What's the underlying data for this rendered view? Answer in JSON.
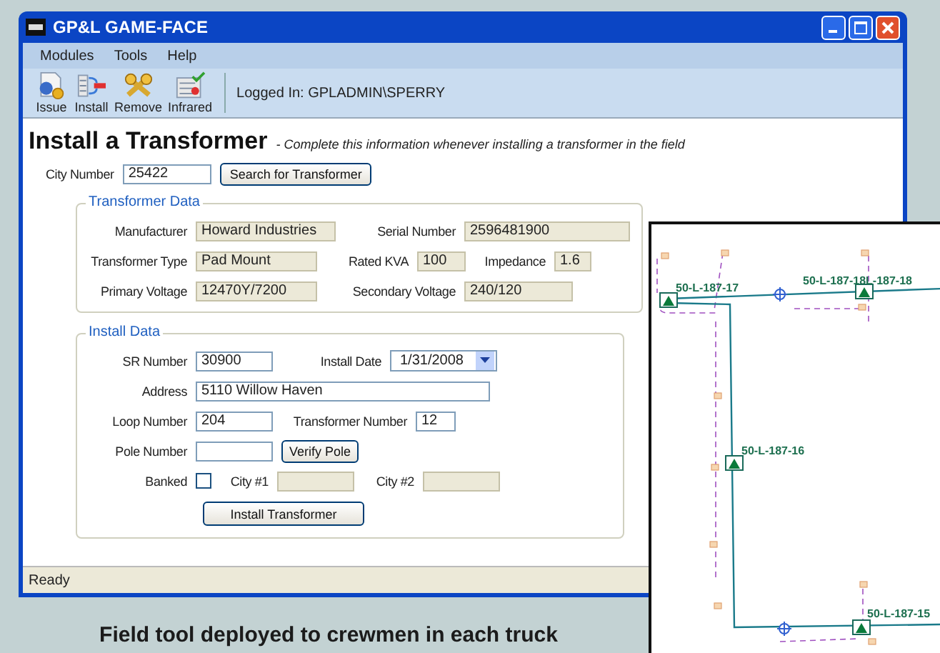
{
  "window": {
    "title": "GP&L GAME-FACE",
    "menu": [
      "Modules",
      "Tools",
      "Help"
    ],
    "toolbar": [
      {
        "kind": "issue",
        "label": "Issue"
      },
      {
        "kind": "install",
        "label": "Install"
      },
      {
        "kind": "remove",
        "label": "Remove"
      },
      {
        "kind": "infrared",
        "label": "Infrared"
      }
    ],
    "logged_in": "Logged In: GPLADMIN\\SPERRY",
    "form": {
      "title": "Install a Transformer",
      "subtitle": "- Complete this information whenever installing a transformer in the field",
      "city_number": {
        "label": "City Number",
        "value": "25422",
        "readonly": false
      },
      "search_button": "Search for Transformer",
      "transformer_data": {
        "legend": "Transformer Data",
        "manufacturer": {
          "label": "Manufacturer",
          "value": "Howard Industries",
          "readonly": true
        },
        "serial_number": {
          "label": "Serial Number",
          "value": "2596481900",
          "readonly": true
        },
        "transformer_type": {
          "label": "Transformer Type",
          "value": "Pad Mount",
          "readonly": true
        },
        "rated_kva": {
          "label": "Rated KVA",
          "value": "100",
          "readonly": true
        },
        "impedance": {
          "label": "Impedance",
          "value": "1.6",
          "readonly": true
        },
        "primary_voltage": {
          "label": "Primary Voltage",
          "value": "12470Y/7200",
          "readonly": true
        },
        "secondary_voltage": {
          "label": "Secondary Voltage",
          "value": "240/120",
          "readonly": true
        }
      },
      "install_data": {
        "legend": "Install Data",
        "sr_number": {
          "label": "SR Number",
          "value": "30900",
          "readonly": false
        },
        "install_date": {
          "label": "Install Date",
          "value": "1/31/2008"
        },
        "address": {
          "label": "Address",
          "value": "5110 Willow Haven",
          "readonly": false
        },
        "loop_number": {
          "label": "Loop Number",
          "value": "204",
          "readonly": false
        },
        "transformer_number": {
          "label": "Transformer Number",
          "value": "12",
          "readonly": false
        },
        "pole_number": {
          "label": "Pole Number",
          "readonly": false
        },
        "verify_button": "Verify Pole",
        "banked": {
          "label": "Banked",
          "checked": false
        },
        "city_1": {
          "label": "City #1",
          "readonly": true
        },
        "city_2": {
          "label": "City #2",
          "readonly": true
        },
        "install_button": "Install Transformer"
      }
    },
    "status_bar": "Ready"
  },
  "map": {
    "labels": [
      "50-L-187-17",
      "50-L-187-18L-187-18",
      "50-L-187-16",
      "50-L-187-15"
    ]
  },
  "caption": "Field tool deployed to crewmen in each truck"
}
